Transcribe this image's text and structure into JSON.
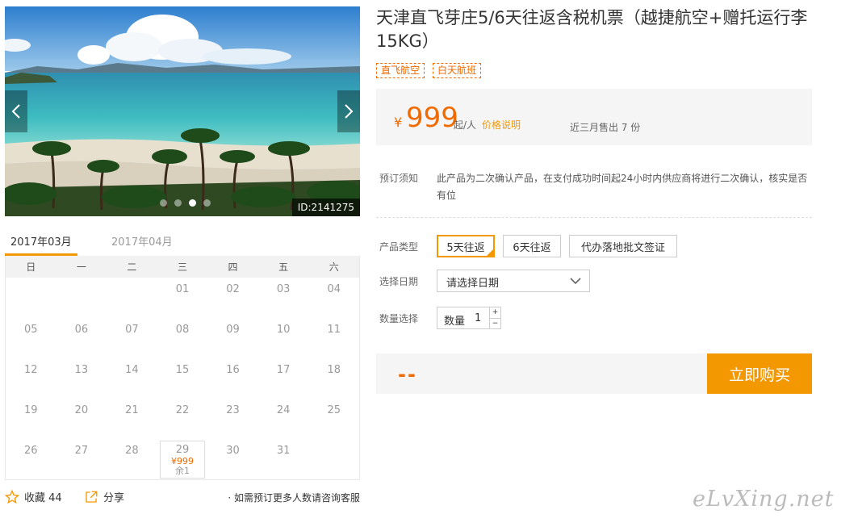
{
  "gallery": {
    "image_id": "ID:2141275",
    "dots": [
      false,
      false,
      true,
      false
    ],
    "prev_icon": "chevron-left-icon",
    "next_icon": "chevron-right-icon"
  },
  "calendar": {
    "months": [
      "2017年03月",
      "2017年04月"
    ],
    "active_month": 0,
    "weekdays": [
      "日",
      "一",
      "二",
      "三",
      "四",
      "五",
      "六"
    ],
    "leading_blanks": 3,
    "days": [
      {
        "d": "01"
      },
      {
        "d": "02"
      },
      {
        "d": "03"
      },
      {
        "d": "04"
      },
      {
        "d": "05"
      },
      {
        "d": "06"
      },
      {
        "d": "07"
      },
      {
        "d": "08"
      },
      {
        "d": "09"
      },
      {
        "d": "10"
      },
      {
        "d": "11"
      },
      {
        "d": "12"
      },
      {
        "d": "13"
      },
      {
        "d": "14"
      },
      {
        "d": "15"
      },
      {
        "d": "16"
      },
      {
        "d": "17"
      },
      {
        "d": "18"
      },
      {
        "d": "19"
      },
      {
        "d": "20"
      },
      {
        "d": "21"
      },
      {
        "d": "22"
      },
      {
        "d": "23"
      },
      {
        "d": "24"
      },
      {
        "d": "25"
      },
      {
        "d": "26"
      },
      {
        "d": "27"
      },
      {
        "d": "28"
      },
      {
        "d": "29",
        "price": "¥999",
        "remain": "余1"
      },
      {
        "d": "30"
      },
      {
        "d": "31"
      }
    ]
  },
  "bottom": {
    "favorite_label": "收藏 44",
    "share_label": "分享",
    "note": "· 如需预订更多人数请咨询客服"
  },
  "product": {
    "title": "天津直飞芽庄5/6天往返含税机票（越捷航空+赠托运行李15KG）",
    "tags": [
      "直飞航空",
      "白天航班"
    ],
    "currency": "¥",
    "price": "999",
    "price_unit": "起/人",
    "price_explain": "价格说明",
    "sold": "近三月售出 7 份",
    "notice_label": "预订须知",
    "notice_text": "此产品为二次确认产品，在支付成功时间起24小时内供应商将进行二次确认，核实是否有位",
    "type_label": "产品类型",
    "types": [
      "5天往返",
      "6天往返",
      "代办落地批文签证"
    ],
    "selected_type": 0,
    "date_label": "选择日期",
    "date_placeholder": "请选择日期",
    "qty_row_label": "数量选择",
    "qty_label": "数量",
    "qty_value": "1",
    "qty_plus": "+",
    "qty_minus": "−",
    "total": "--",
    "buy_label": "立即购买"
  },
  "watermark": "eLvXing.net",
  "colors": {
    "accent": "#f39800",
    "price": "#f06a00"
  }
}
